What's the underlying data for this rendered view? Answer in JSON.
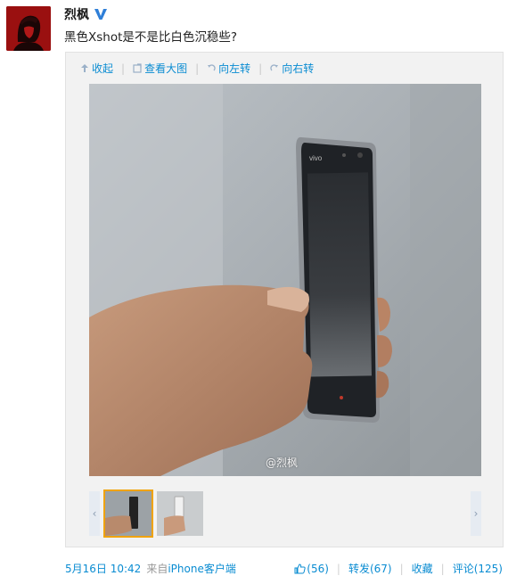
{
  "user": {
    "name": "烈枫",
    "verified": true
  },
  "post": {
    "text": "黑色Xshot是不是比白色沉稳些?"
  },
  "toolbar": {
    "collapse": "收起",
    "view_large": "查看大图",
    "rotate_left": "向左转",
    "rotate_right": "向右转"
  },
  "photo": {
    "watermark": "@烈枫"
  },
  "meta": {
    "time": "5月16日 10:42",
    "from_prefix": "来自",
    "source": "iPhone客户端"
  },
  "actions": {
    "like_count": "(56)",
    "repost": "转发(67)",
    "favorite": "收藏",
    "comment": "评论(125)"
  },
  "colors": {
    "link": "#0a8cd2",
    "thumb_selected": "#f0a30a",
    "verified": "#2f7fd8"
  }
}
